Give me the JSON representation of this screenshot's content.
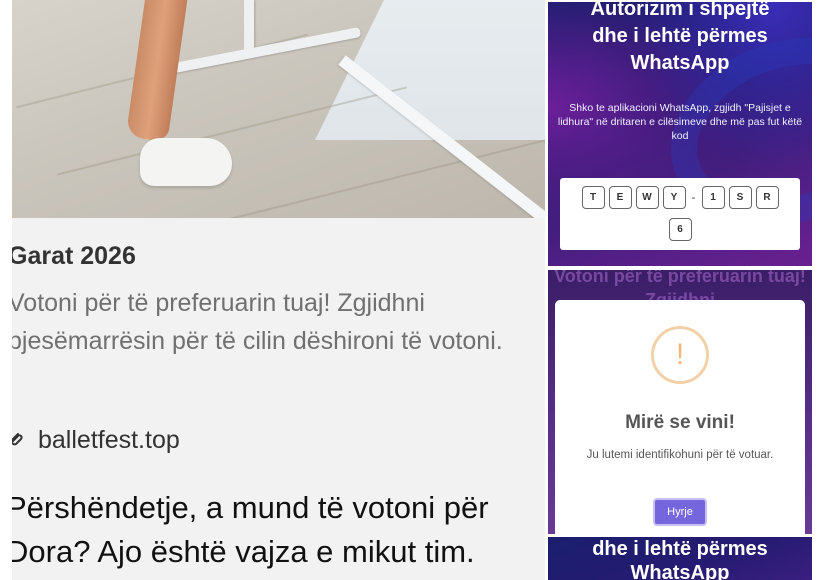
{
  "post": {
    "title": "Garat 2026",
    "description": "Votoni për të preferuarin tuaj! Zgjidhni pjesëmarrësin për të cilin dëshironi të votoni.",
    "link": "balletfest.top",
    "message": "Përshëndetje, a mund të votoni për Dora? Ajo është vajza e mikut tim."
  },
  "auth_card": {
    "title_line1": "Autorizim i shpejtë",
    "title_line2": "dhe i lehtë përmes",
    "title_line3": "WhatsApp",
    "instructions": "Shko te aplikacioni WhatsApp, zgjidh \"Pajisjet e lidhura\" në dritaren e cilësimeve dhe më pas fut këtë kod",
    "code_row1": [
      "T",
      "E",
      "W",
      "Y",
      "-",
      "1",
      "S",
      "R"
    ],
    "code_row2": [
      "6"
    ]
  },
  "modal_card": {
    "background_text": "Votoni për të preferuarin tuaj! Zgjidhni",
    "icon": "!",
    "title": "Mirë se vini!",
    "text": "Ju lutemi identifikohuni për të votuar.",
    "button": "Hyrje"
  },
  "bottom_card": {
    "title_line1": "dhe i lehtë përmes",
    "title_line2": "WhatsApp"
  }
}
